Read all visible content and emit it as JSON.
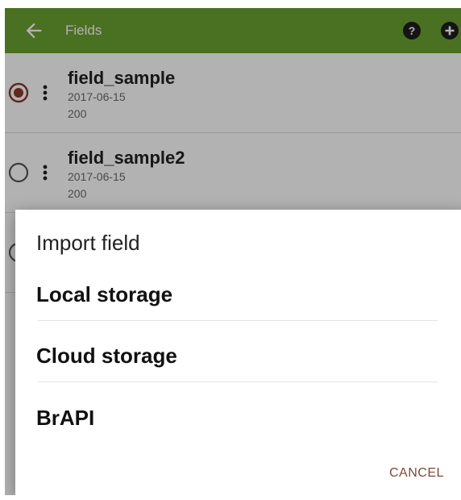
{
  "appbar": {
    "title": "Fields",
    "color": "#6aa132",
    "icons": [
      "arrow-back-icon",
      "help-icon",
      "add-icon"
    ]
  },
  "fields": [
    {
      "name": "field_sample",
      "date": "2017-06-15",
      "count": "200",
      "selected": true
    },
    {
      "name": "field_sample2",
      "date": "2017-06-15",
      "count": "200",
      "selected": false
    }
  ],
  "dialog": {
    "title": "Import field",
    "options": [
      "Local storage",
      "Cloud storage",
      "BrAPI"
    ],
    "cancel_label": "CANCEL"
  },
  "colors": {
    "accent": "#6aa132",
    "selected_radio": "#8c3a2c",
    "cancel_text": "#7b4a3a"
  }
}
